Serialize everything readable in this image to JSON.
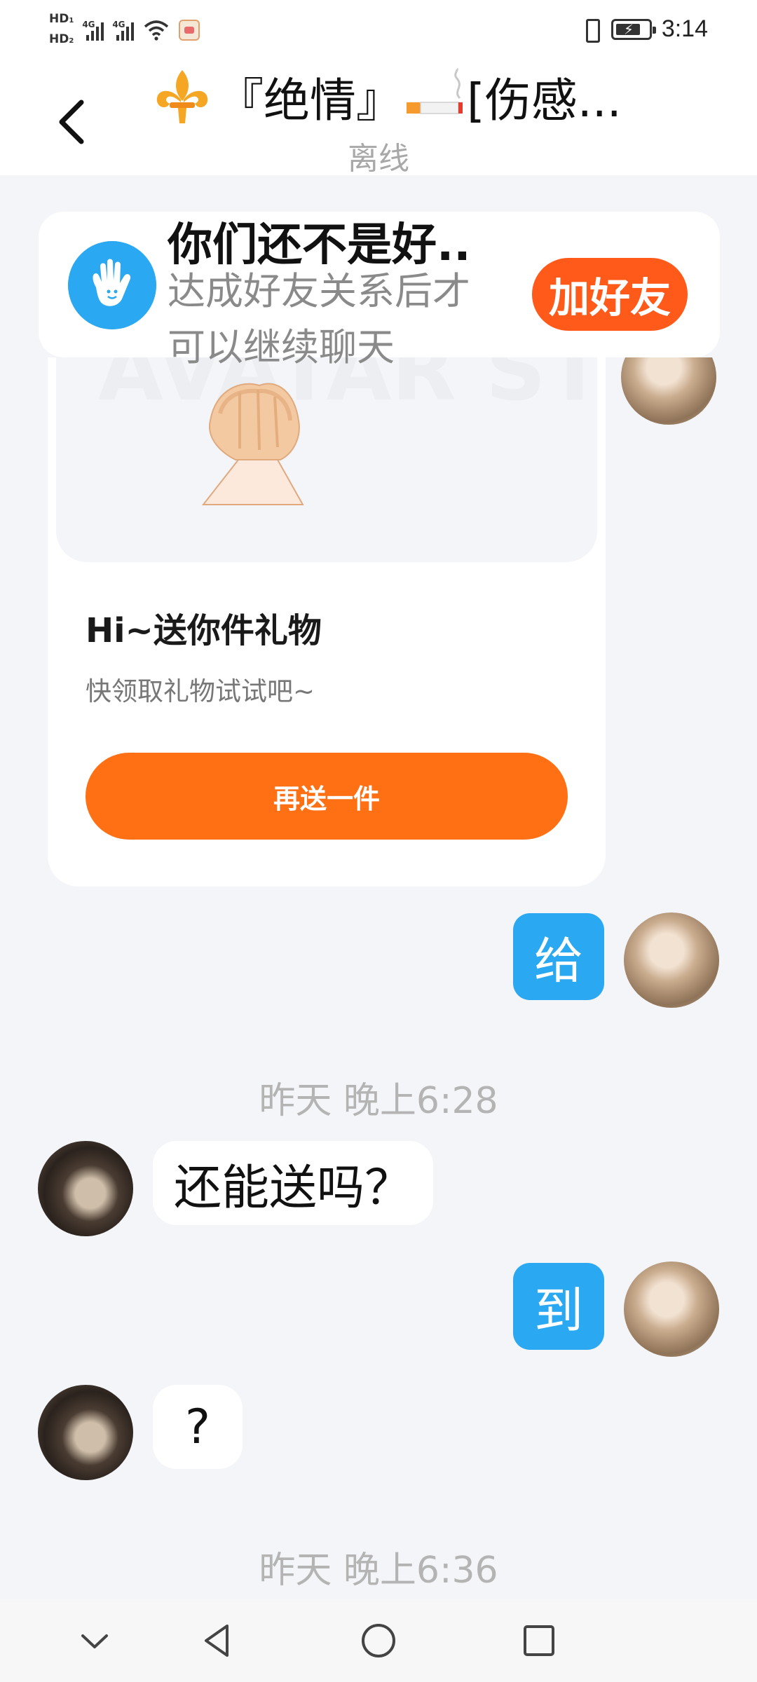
{
  "status_bar": {
    "sim1": "HD",
    "sim1_index": "1",
    "sim2": "HD",
    "sim2_index": "2",
    "network1": "4G",
    "network2": "4G",
    "time": "3:14",
    "icons": [
      "signal-icon",
      "wifi-icon",
      "app-notification-icon",
      "vibrate-icon",
      "battery-charging-icon"
    ]
  },
  "header": {
    "title_part1": "『绝情』",
    "title_part2": "[伤感...",
    "status": "离线",
    "icons": [
      "back-arrow-icon",
      "fleur-de-lis-icon",
      "cigarette-icon"
    ]
  },
  "friend_banner": {
    "title": "你们还不是好..",
    "description": "达成好友关系后才可以继续聊天",
    "button": "加好友",
    "icon": "hand-wave-icon"
  },
  "gift_card": {
    "title": "Hi~送你件礼物",
    "description": "快领取礼物试试吧~",
    "button": "再送一件",
    "watermark": "AVATAR STORE"
  },
  "messages": [
    {
      "sender": "me",
      "text": "给"
    },
    {
      "timestamp": "昨天 晚上6:28"
    },
    {
      "sender": "other",
      "text": "还能送吗？"
    },
    {
      "sender": "me",
      "text": "到"
    },
    {
      "sender": "other",
      "text": "?"
    },
    {
      "timestamp": "昨天 晚上6:36"
    }
  ],
  "nav_bar": {
    "icons": [
      "collapse-chevron-icon",
      "back-triangle-icon",
      "home-circle-icon",
      "recents-square-icon"
    ]
  },
  "colors": {
    "accent_blue": "#2aa9f2",
    "accent_orange": "#ff6f14",
    "add_friend_orange": "#ff5a1a",
    "background": "#f3f5f8"
  }
}
